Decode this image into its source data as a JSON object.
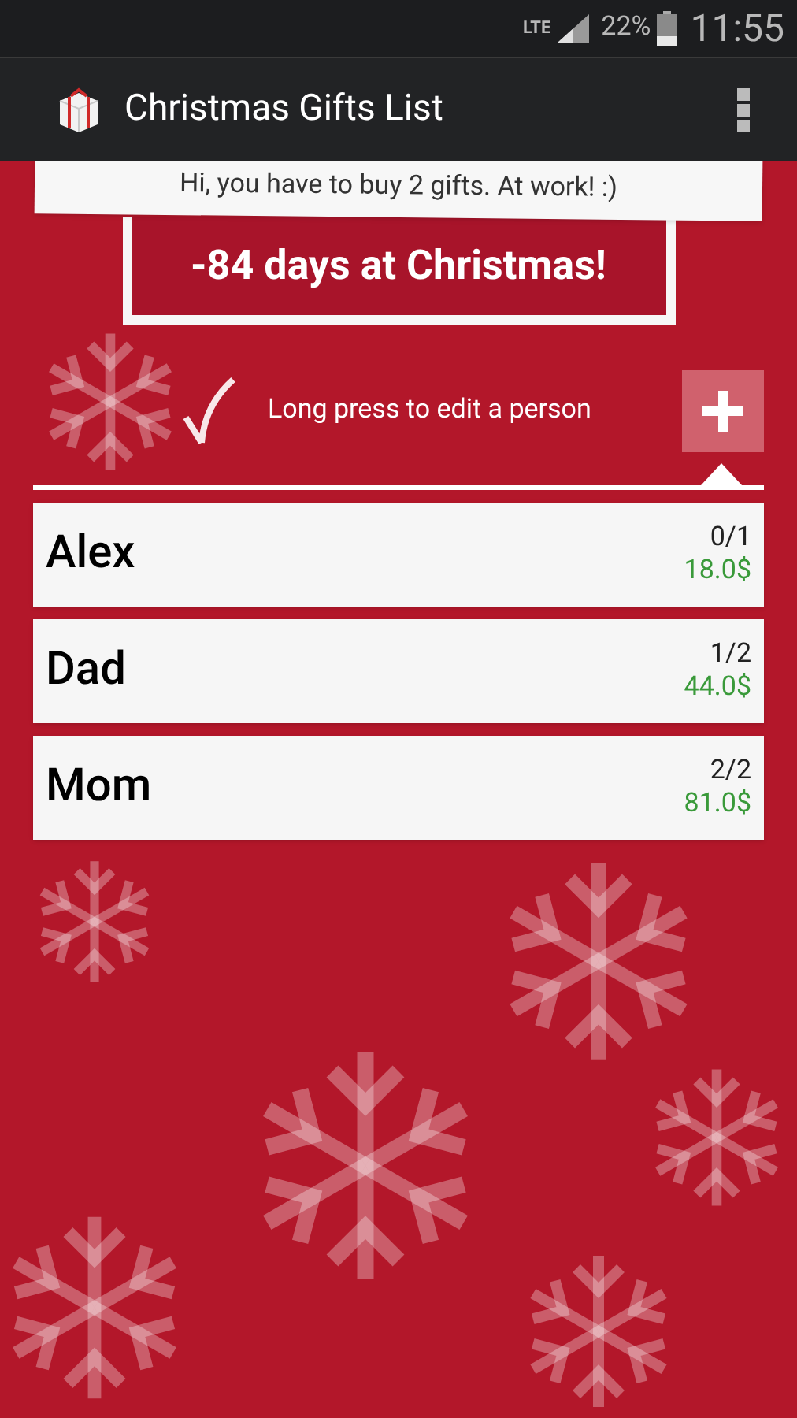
{
  "status_bar": {
    "network": "LTE",
    "battery": "22%",
    "time": "11:55"
  },
  "action_bar": {
    "title": "Christmas Gifts List"
  },
  "banner": {
    "message": "Hi, you have to buy 2 gifts. At work! :)",
    "countdown": "-84 days at Christmas!"
  },
  "hint": {
    "text": "Long press to edit a person"
  },
  "people": [
    {
      "name": "Alex",
      "progress": "0/1",
      "amount": "18.0$"
    },
    {
      "name": "Dad",
      "progress": "1/2",
      "amount": "44.0$"
    },
    {
      "name": "Mom",
      "progress": "2/2",
      "amount": "81.0$"
    }
  ]
}
